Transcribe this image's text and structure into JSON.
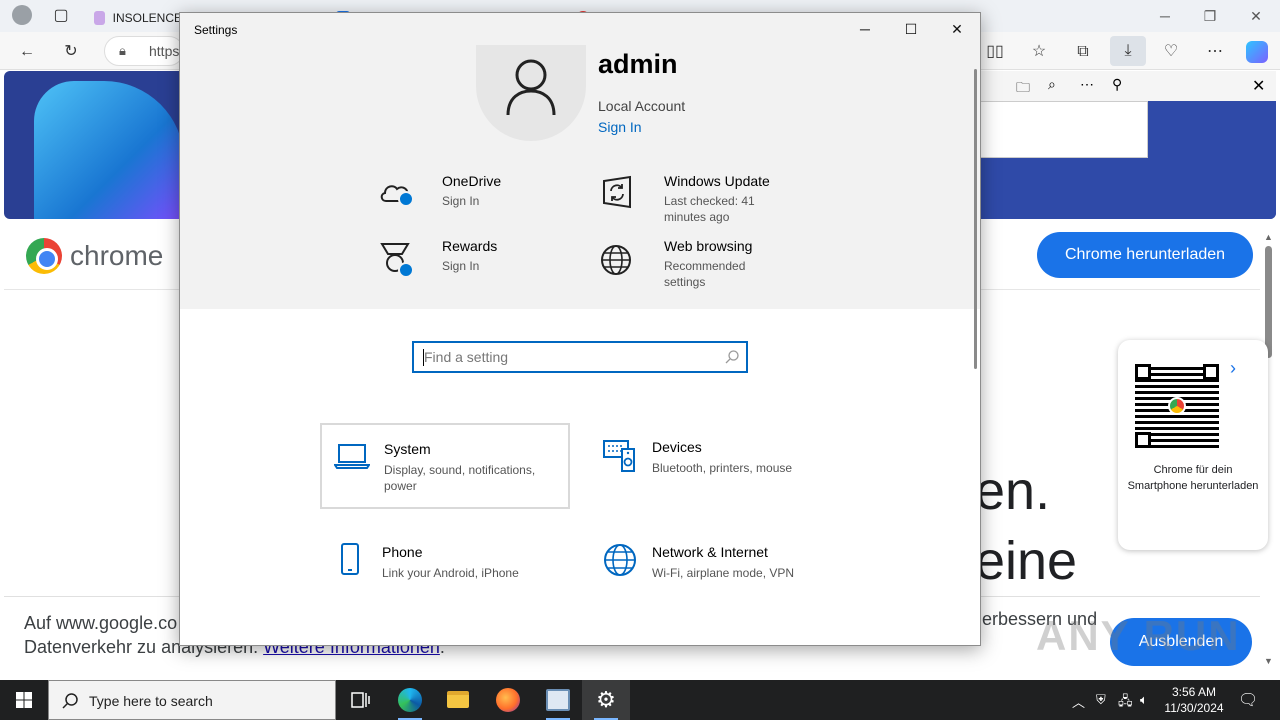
{
  "browser": {
    "tabs": [
      {
        "label": "INSOLENCE",
        "color": "#c9a7e8"
      },
      {
        "label": "",
        "color": "#1a73e8"
      },
      {
        "label": "",
        "color": "#e53935"
      }
    ],
    "address_prefix": "https",
    "chrome_word": "chrome",
    "download_button": "Chrome herunterladen",
    "qr_caption": "Chrome für dein Smartphone herunterladen",
    "big_text_1": "en.",
    "big_text_2": "eine",
    "cookie_line1": "Auf www.google.co",
    "cookie_line2_a": "Datenverkehr zu analysieren. ",
    "cookie_link": "Weitere Informationen",
    "cookie_line2_b": ".",
    "cookie_right": "erbessern und",
    "hide_button": "Ausblenden",
    "watermark": "ANY RUN"
  },
  "settings": {
    "window_title": "Settings",
    "user": {
      "name": "admin",
      "account_type": "Local Account",
      "sign_in": "Sign In"
    },
    "quick_actions": [
      {
        "title": "OneDrive",
        "subtitle": "Sign In",
        "icon": "onedrive-icon"
      },
      {
        "title": "Windows Update",
        "subtitle": "Last checked: 41 minutes ago",
        "icon": "windows-update-icon"
      },
      {
        "title": "Rewards",
        "subtitle": "Sign In",
        "icon": "rewards-icon"
      },
      {
        "title": "Web browsing",
        "subtitle": "Recommended settings",
        "icon": "globe-icon"
      }
    ],
    "search_placeholder": "Find a setting",
    "categories": [
      {
        "title": "System",
        "subtitle": "Display, sound, notifications, power",
        "icon": "laptop-icon"
      },
      {
        "title": "Devices",
        "subtitle": "Bluetooth, printers, mouse",
        "icon": "devices-icon"
      },
      {
        "title": "Phone",
        "subtitle": "Link your Android, iPhone",
        "icon": "phone-icon"
      },
      {
        "title": "Network & Internet",
        "subtitle": "Wi-Fi, airplane mode, VPN",
        "icon": "network-icon"
      }
    ],
    "accent_color": "#0067c0"
  },
  "taskbar": {
    "search_placeholder": "Type here to search",
    "time": "3:56 AM",
    "date": "11/30/2024"
  }
}
